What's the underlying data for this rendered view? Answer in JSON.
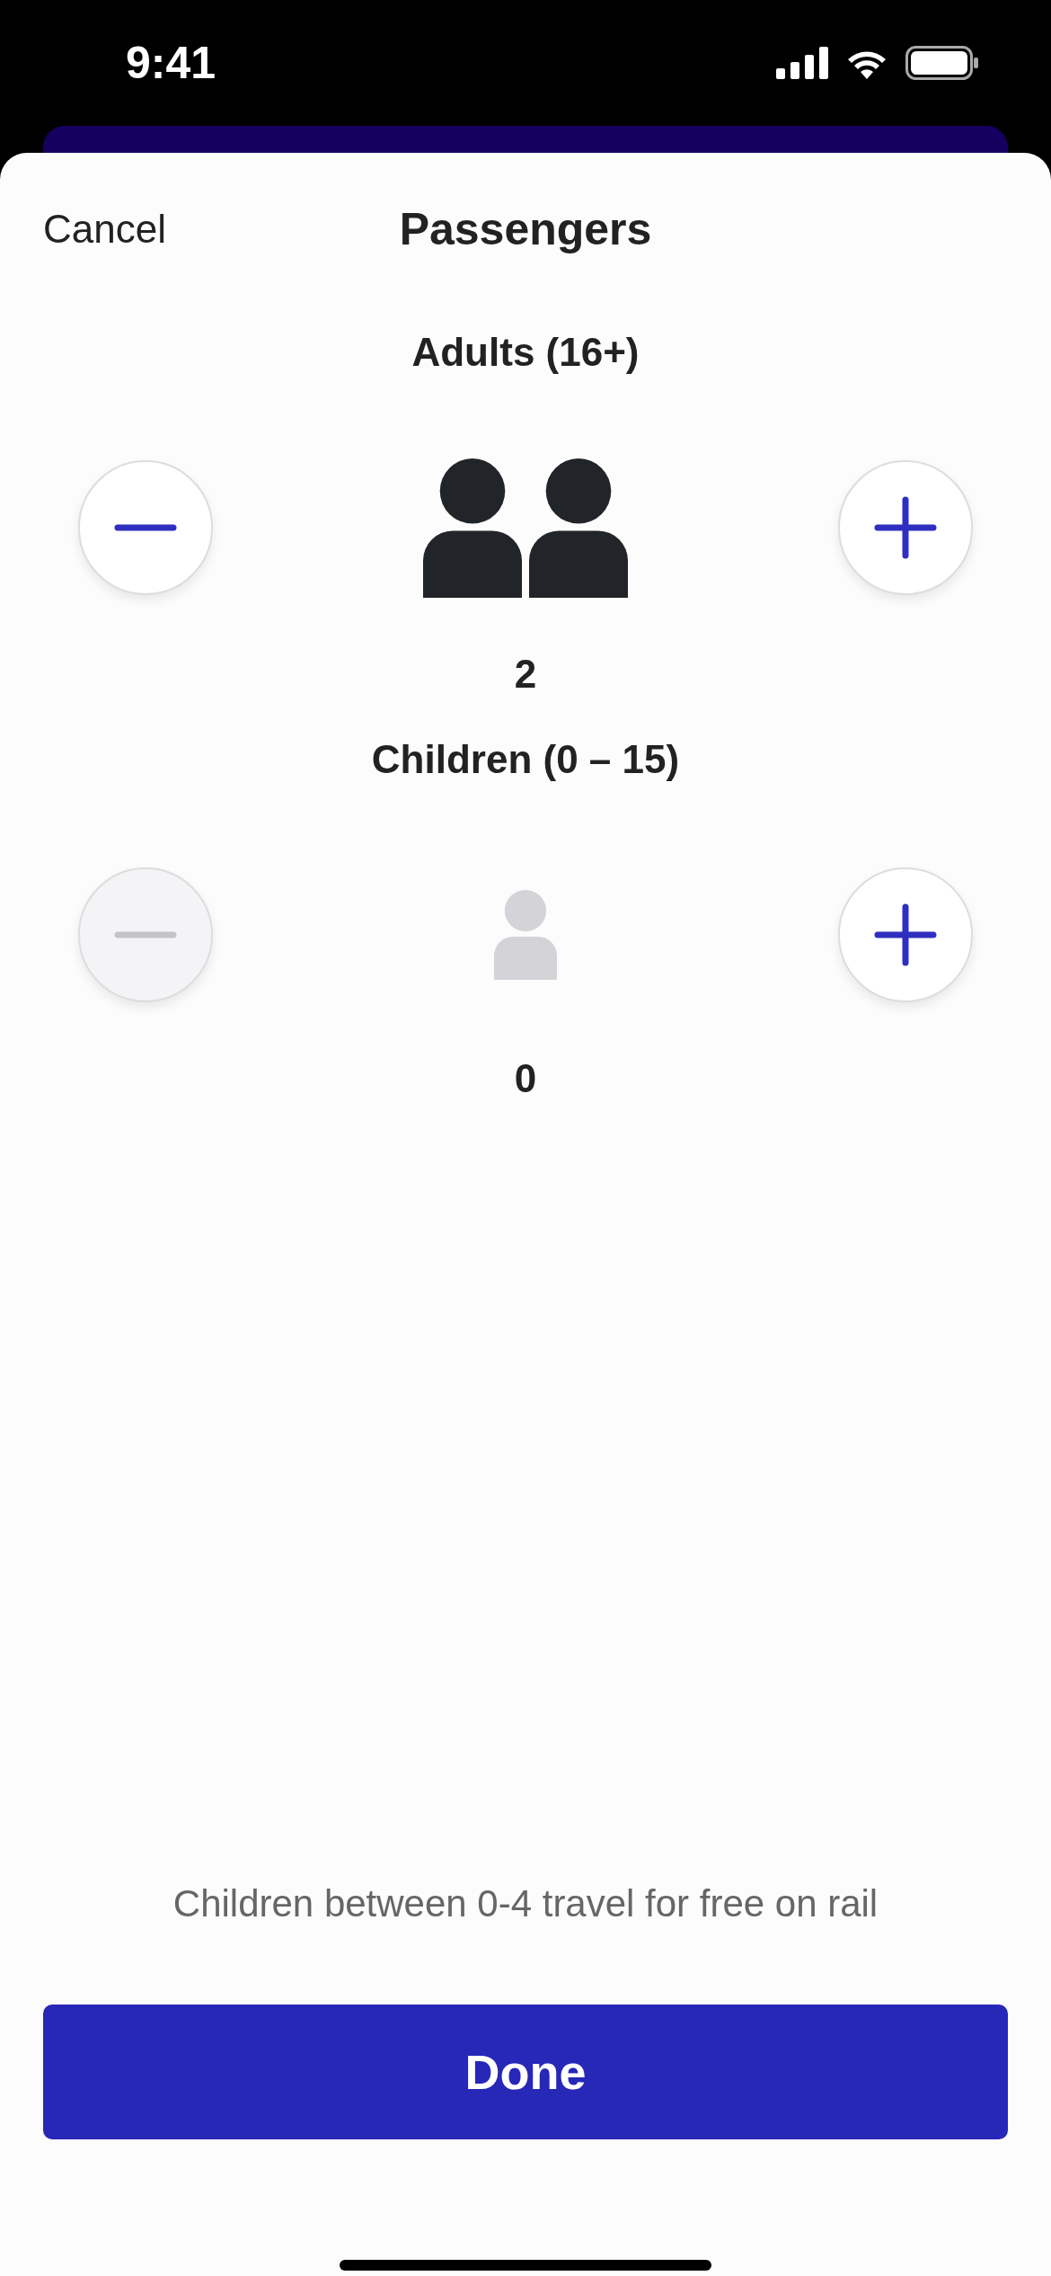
{
  "status_bar": {
    "time": "9:41"
  },
  "header": {
    "cancel": "Cancel",
    "title": "Passengers"
  },
  "groups": [
    {
      "kind": "adult",
      "label": "Adults (16+)",
      "count": "2",
      "decrease_disabled": false,
      "increase_disabled": false
    },
    {
      "kind": "child",
      "label": "Children (0 – 15)",
      "count": "0",
      "decrease_disabled": true,
      "increase_disabled": false
    }
  ],
  "footnote": "Children between 0-4 travel for free on rail",
  "done_button": "Done"
}
